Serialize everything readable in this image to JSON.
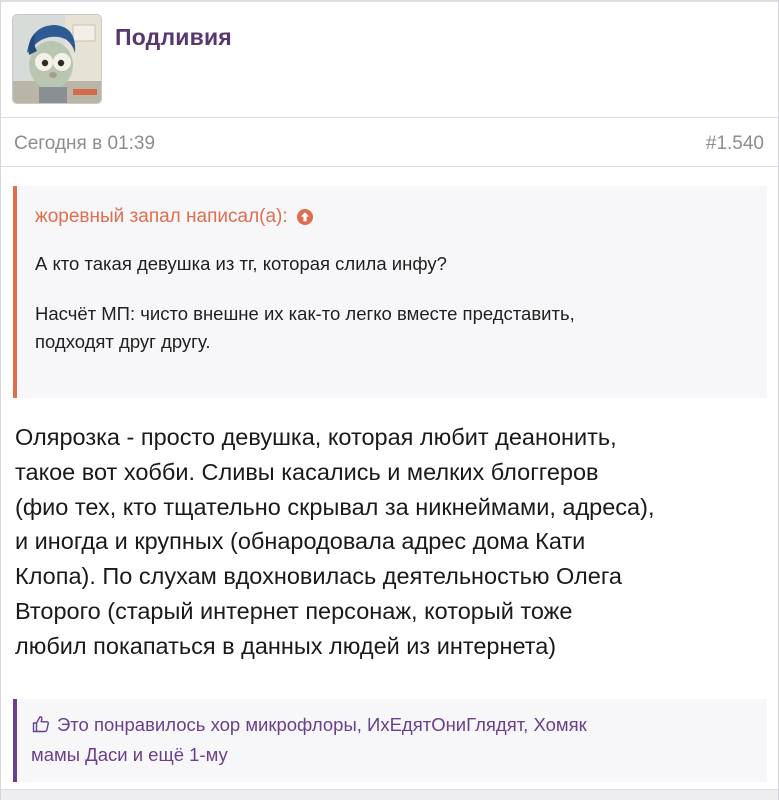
{
  "post": {
    "author": "Подливия",
    "timestamp": "Сегодня в 01:39",
    "number": "#1.540"
  },
  "quote": {
    "header": "жоревный запал написал(а):",
    "icon": "arrow-up-circle-icon",
    "lines": [
      "А кто такая девушка из тг, которая слила инфу?",
      "Насчёт МП: чисто внешне их как-то легко вместе представить,",
      "подходят друг другу."
    ]
  },
  "message": {
    "lines": [
      "Олярозка - просто девушка, которая любит деанонить,",
      "такое вот хобби. Сливы касались и мелких блоггеров",
      "(фио тех, кто тщательно скрывал за никнеймами, адреса),",
      "и иногда и крупных (обнародовала адрес дома Кати",
      "Клопа). По слухам вдохновилась деятельностью Олега",
      "Второго (старый интернет персонаж, который тоже",
      "любил покапаться в данных людей из интернета)"
    ]
  },
  "likes": {
    "icon": "thumbs-up-icon",
    "line1": "Это понравилось хор микрофлоры, ИхЕдятОниГлядят, Хомяк",
    "line2": "мамы Даси и ещё 1-му"
  },
  "colors": {
    "username": "#58376f",
    "quote_accent": "#e06e4c",
    "likes_accent": "#6a3f8c",
    "meta_text": "#8c8c93"
  }
}
